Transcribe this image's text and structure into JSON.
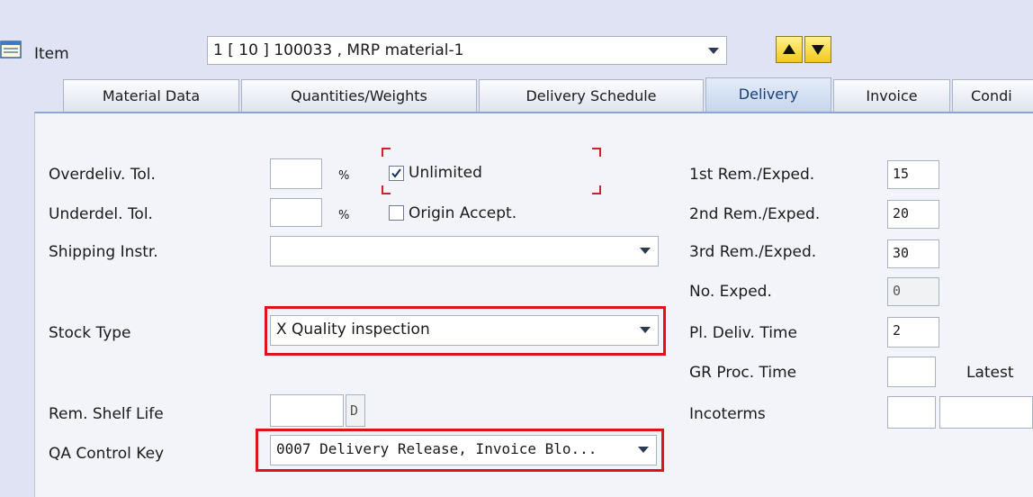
{
  "header": {
    "item_label": "Item",
    "item_value": "1 [ 10 ] 100033 , MRP material-1"
  },
  "tabs": [
    {
      "label": "Material Data"
    },
    {
      "label": "Quantities/Weights"
    },
    {
      "label": "Delivery Schedule"
    },
    {
      "label": "Delivery"
    },
    {
      "label": "Invoice"
    },
    {
      "label": "Condi"
    }
  ],
  "left": {
    "overdeliv_label": "Overdeliv. Tol.",
    "overdeliv_value": "",
    "overdeliv_unit": "%",
    "unlimited_label": "Unlimited",
    "unlimited_checked": true,
    "underdel_label": "Underdel. Tol.",
    "underdel_value": "",
    "underdel_unit": "%",
    "origin_label": "Origin Accept.",
    "origin_checked": false,
    "shipping_label": "Shipping Instr.",
    "shipping_value": "",
    "stock_type_label": "Stock Type",
    "stock_type_value": "X Quality inspection",
    "shelf_life_label": "Rem. Shelf Life",
    "shelf_life_value": "",
    "shelf_life_unit": "D",
    "qa_key_label": "QA Control Key",
    "qa_key_value": "0007 Delivery Release, Invoice Blo..."
  },
  "right": {
    "rem1_label": "1st Rem./Exped.",
    "rem1_value": "15",
    "rem2_label": "2nd Rem./Exped.",
    "rem2_value": "20",
    "rem3_label": "3rd Rem./Exped.",
    "rem3_value": "30",
    "noexped_label": "No. Exped.",
    "noexped_value": "0",
    "pldeliv_label": "Pl. Deliv. Time",
    "pldeliv_value": "2",
    "grproc_label": "GR Proc. Time",
    "grproc_value": "",
    "latest_label": "Latest",
    "incoterms_label": "Incoterms",
    "incoterms_value1": "",
    "incoterms_value2": ""
  },
  "colors": {
    "highlight": "#e0121c",
    "active_tab": "#173f7a"
  }
}
